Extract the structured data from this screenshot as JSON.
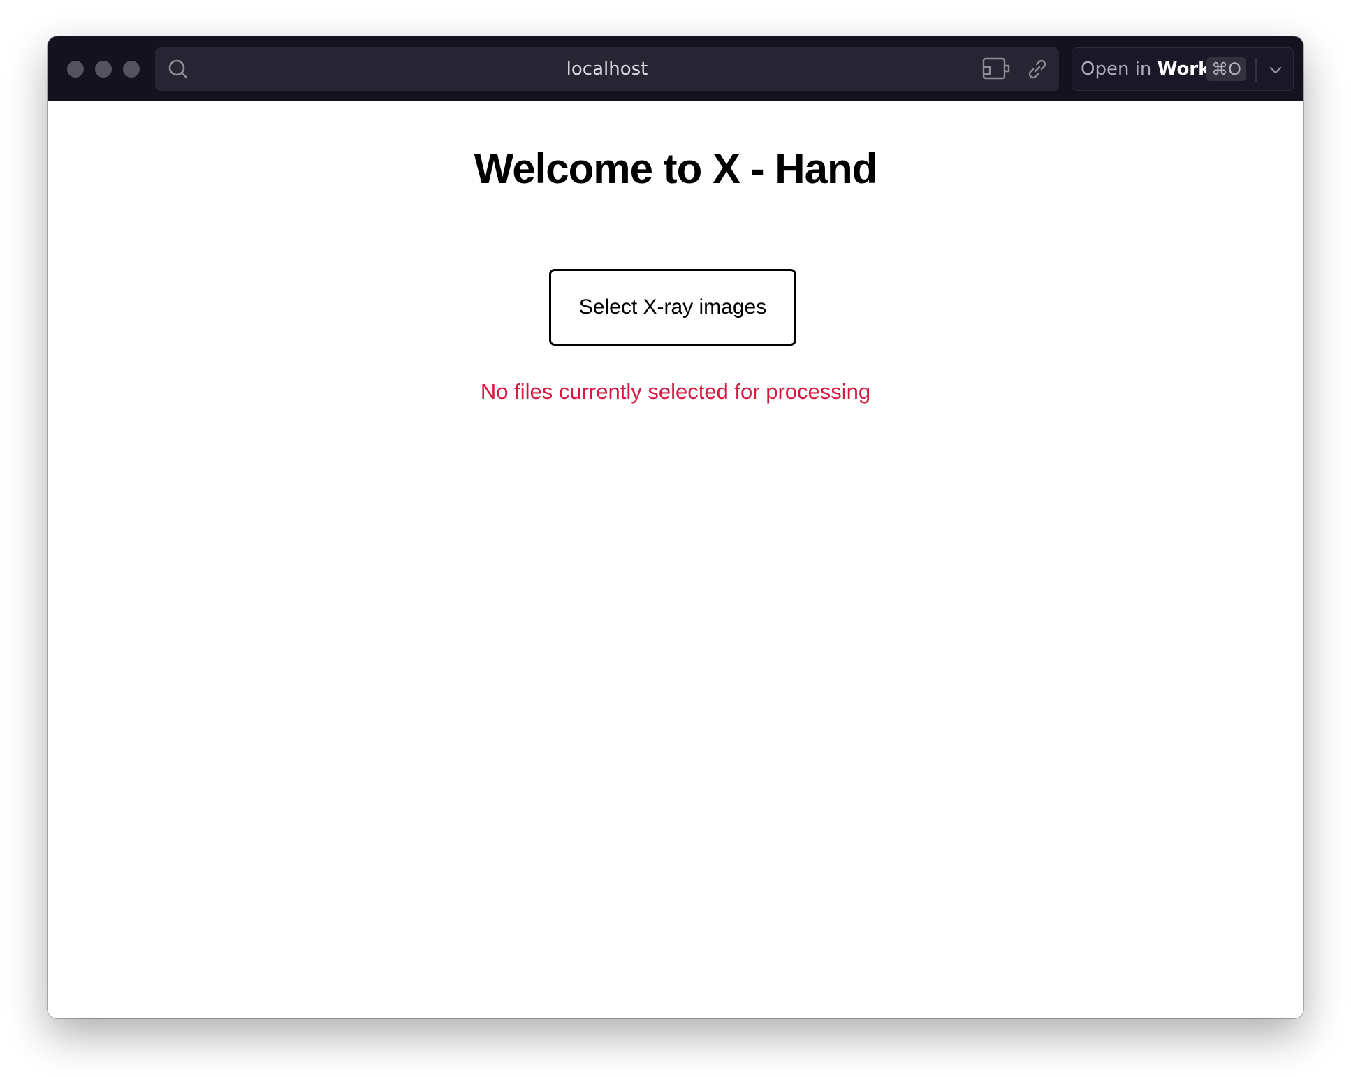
{
  "browser": {
    "url": "localhost",
    "open_in_prefix": "Open in",
    "open_in_target": "Work",
    "open_in_shortcut": "⌘O"
  },
  "page": {
    "heading": "Welcome to X - Hand",
    "select_button_label": "Select X-ray images",
    "status_message": "No files currently selected for processing"
  },
  "colors": {
    "titlebar": "#15121f",
    "status_text": "#d8183f"
  },
  "icons": [
    "search-icon",
    "screen-share-icon",
    "link-icon",
    "chevron-down-icon"
  ]
}
